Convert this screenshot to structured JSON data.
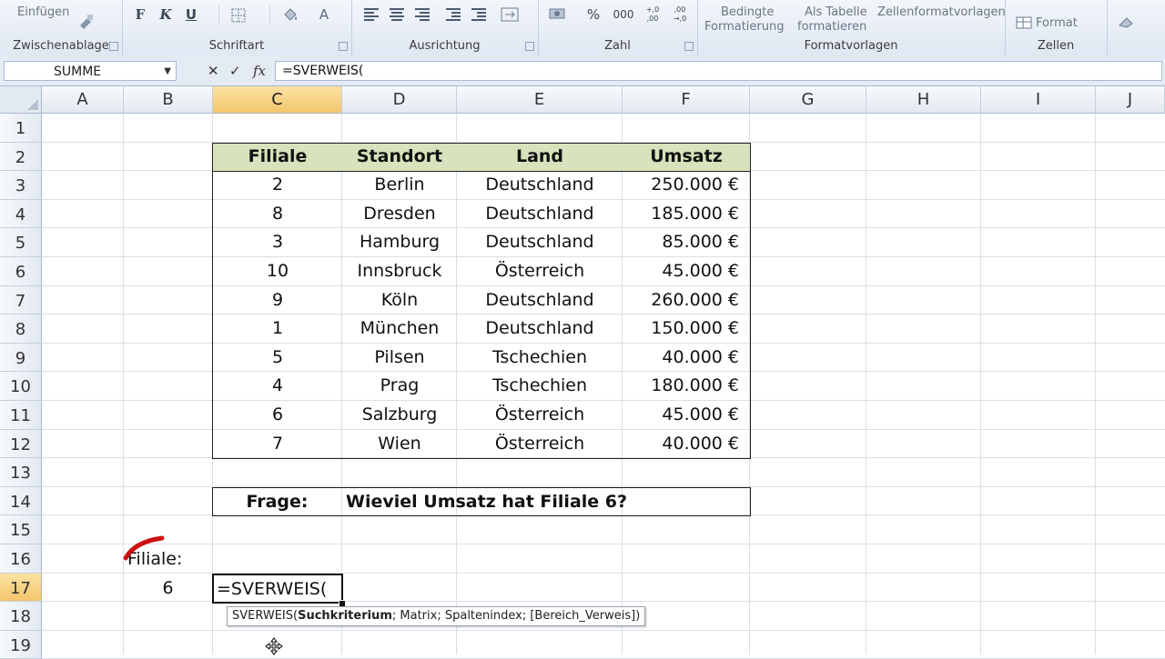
{
  "ribbon": {
    "clipboard": {
      "paste": "Einfügen",
      "label": "Zwischenablage"
    },
    "font": {
      "bold": "F",
      "italic": "K",
      "underline": "U",
      "color": "A",
      "label": "Schriftart"
    },
    "alignment": {
      "label": "Ausrichtung"
    },
    "number": {
      "percent": "%",
      "thousands": "000",
      "dec_inc": "+,0 ,00",
      "dec_dec": ",00 →,0",
      "label": "Zahl"
    },
    "styles": {
      "conditional_1": "Bedingte",
      "conditional_2": "Formatierung",
      "as_table_1": "Als Tabelle",
      "as_table_2": "formatieren",
      "cell_styles": "Zellenformatvorlagen",
      "label": "Formatvorlagen"
    },
    "cells": {
      "format": "Format",
      "label": "Zellen"
    }
  },
  "formula_bar": {
    "name_box": "SUMME",
    "cancel": "✕",
    "enter": "✓",
    "fx": "fx",
    "formula": "=SVERWEIS("
  },
  "columns": [
    "A",
    "B",
    "C",
    "D",
    "E",
    "F",
    "G",
    "H",
    "I",
    "J"
  ],
  "rows": [
    "1",
    "2",
    "3",
    "4",
    "5",
    "6",
    "7",
    "8",
    "9",
    "10",
    "11",
    "12",
    "13",
    "14",
    "15",
    "16",
    "17",
    "18",
    "19"
  ],
  "table": {
    "headers": [
      "Filiale",
      "Standort",
      "Land",
      "Umsatz"
    ],
    "rows": [
      [
        "2",
        "Berlin",
        "Deutschland",
        "250.000 €"
      ],
      [
        "8",
        "Dresden",
        "Deutschland",
        "185.000 €"
      ],
      [
        "3",
        "Hamburg",
        "Deutschland",
        "85.000 €"
      ],
      [
        "10",
        "Innsbruck",
        "Österreich",
        "45.000 €"
      ],
      [
        "9",
        "Köln",
        "Deutschland",
        "260.000 €"
      ],
      [
        "1",
        "München",
        "Deutschland",
        "150.000 €"
      ],
      [
        "5",
        "Pilsen",
        "Tschechien",
        "40.000 €"
      ],
      [
        "4",
        "Prag",
        "Tschechien",
        "180.000 €"
      ],
      [
        "6",
        "Salzburg",
        "Österreich",
        "45.000 €"
      ],
      [
        "7",
        "Wien",
        "Österreich",
        "40.000 €"
      ]
    ]
  },
  "question": {
    "label": "Frage:",
    "text": "Wieviel Umsatz hat Filiale 6?"
  },
  "lookup": {
    "label": "Filiale:",
    "value": "6"
  },
  "active_cell": {
    "ref": "C17",
    "content": "=SVERWEIS("
  },
  "tooltip": {
    "fn": "SVERWEIS(",
    "arg_current": "Suchkriterium",
    "rest": "; Matrix; Spaltenindex; [Bereich_Verweis])"
  },
  "colors": {
    "header_fill": "#d6e3bc",
    "selected_header": "#f4c56c",
    "annotation": "#cc1111"
  }
}
